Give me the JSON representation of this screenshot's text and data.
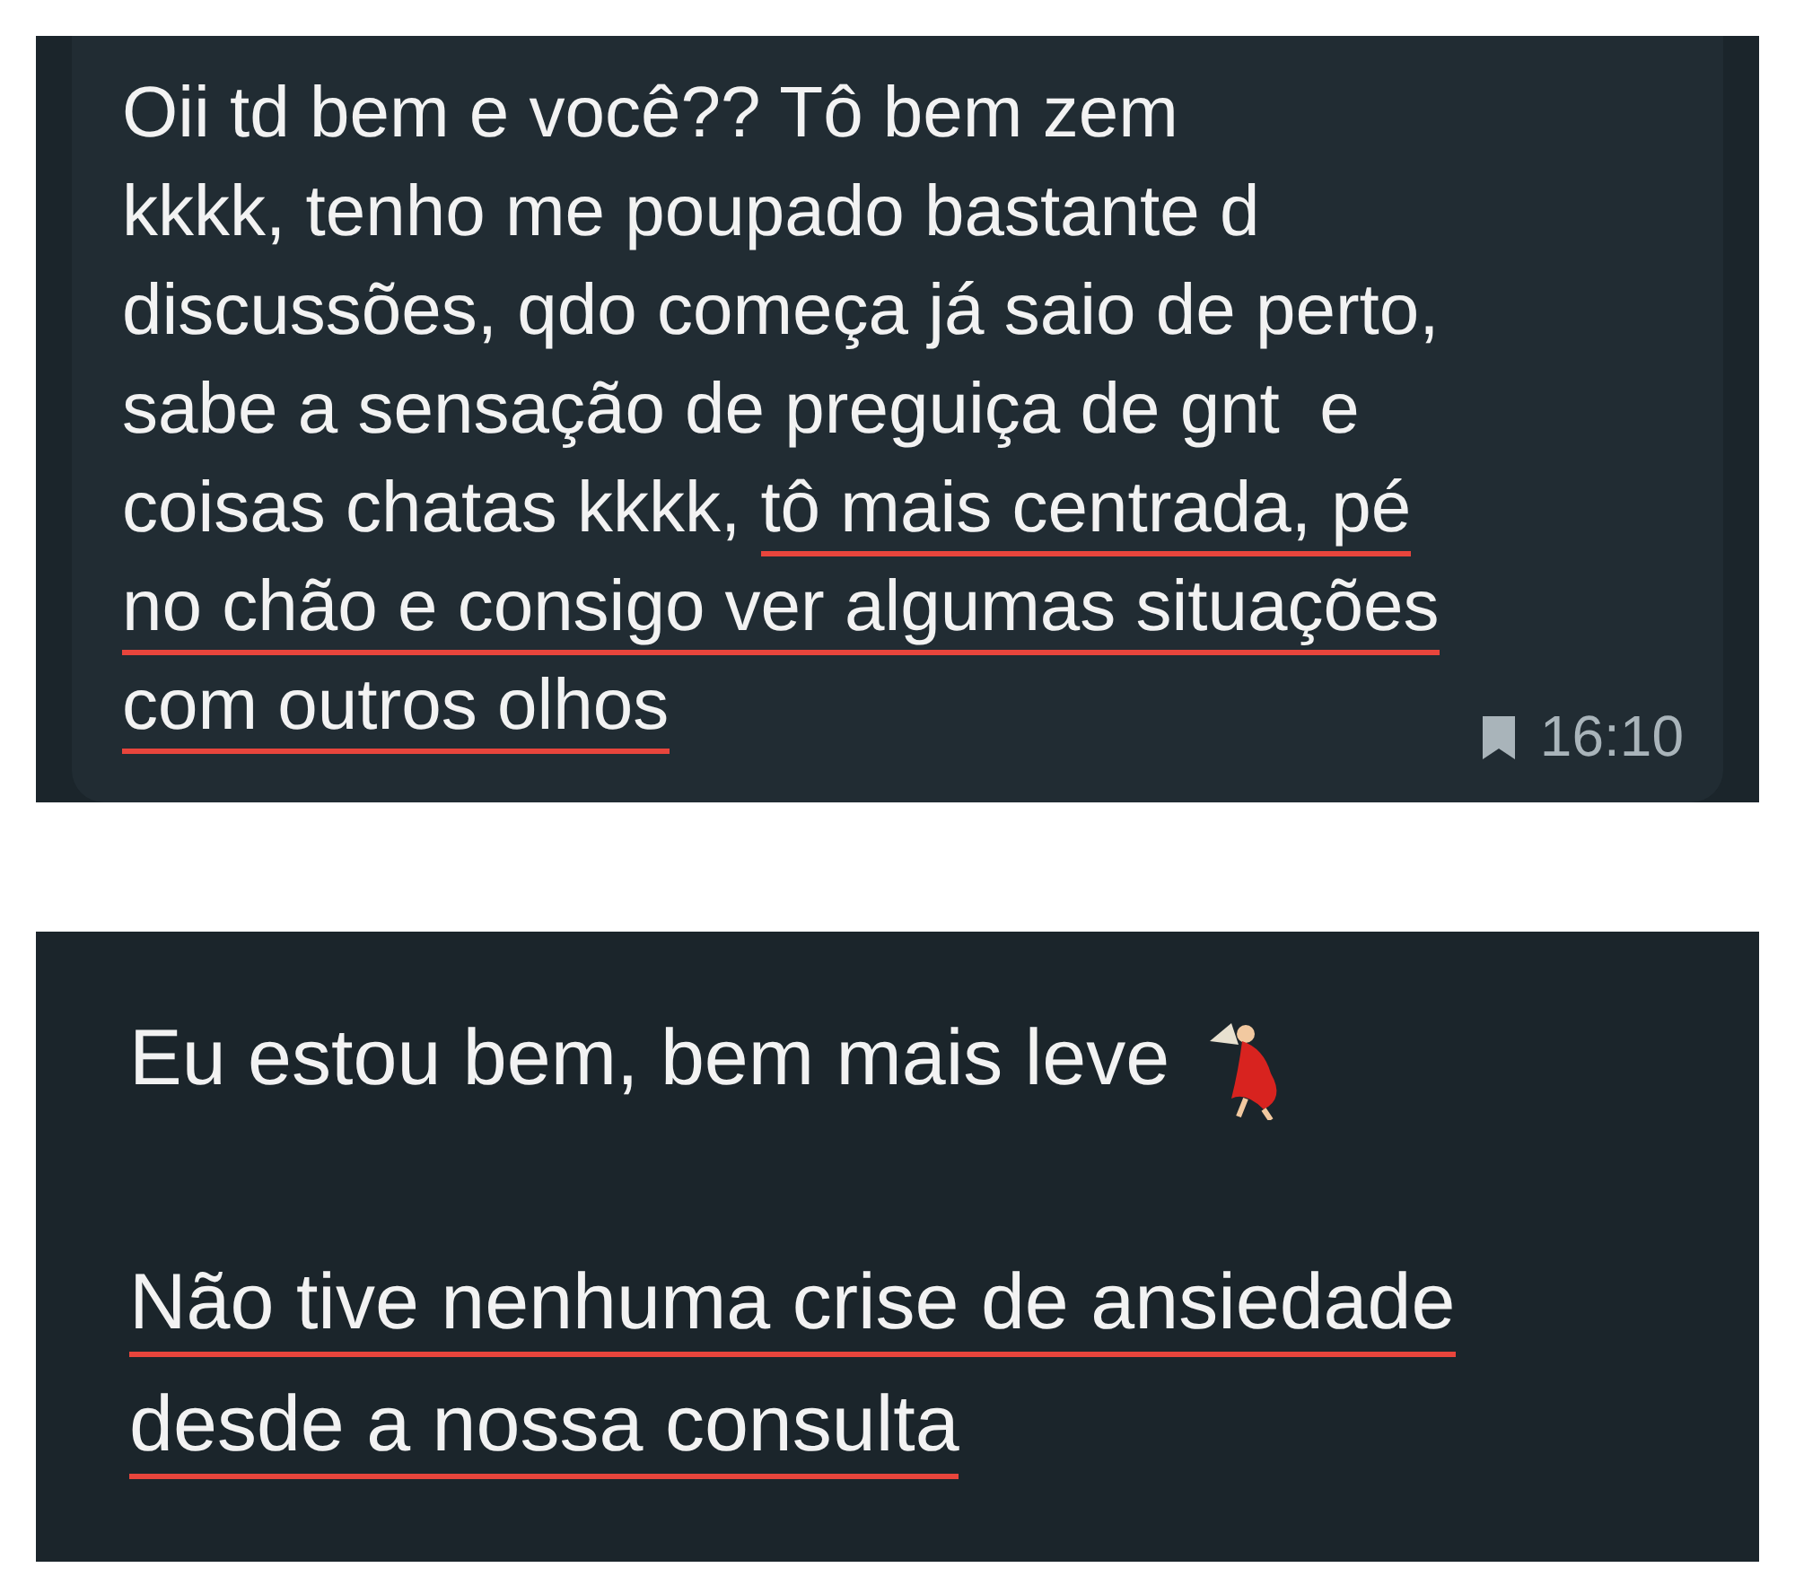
{
  "messages": [
    {
      "paragraphs": [
        [
          [
            {
              "text": "Oii td bem e você?? Tô bem zem",
              "underlined": false
            }
          ],
          [
            {
              "text": "kkkk, tenho me poupado bastante d",
              "underlined": false
            }
          ],
          [
            {
              "text": "discussões, qdo começa já saio de perto,",
              "underlined": false
            }
          ],
          [
            {
              "text": "sabe a sensação de preguiça de gnt  e",
              "underlined": false
            }
          ],
          [
            {
              "text": "coisas chatas kkkk, ",
              "underlined": false
            },
            {
              "text": "tô mais centrada, pé",
              "underlined": true
            }
          ],
          [
            {
              "text": "no chão e consigo ver algumas situações",
              "underlined": true
            }
          ],
          [
            {
              "text": "com outros olhos",
              "underlined": true
            }
          ]
        ]
      ],
      "time": "16:10",
      "bookmarked": true
    },
    {
      "paragraphs": [
        [
          [
            {
              "text": "Eu estou bem, bem mais leve ",
              "underlined": false
            },
            {
              "kind": "emoji"
            }
          ]
        ],
        [
          [
            {
              "text": "Não tive nenhuma crise de ansiedade",
              "underlined": true
            }
          ],
          [
            {
              "text": "desde a nossa consulta",
              "underlined": true
            }
          ]
        ]
      ]
    }
  ]
}
